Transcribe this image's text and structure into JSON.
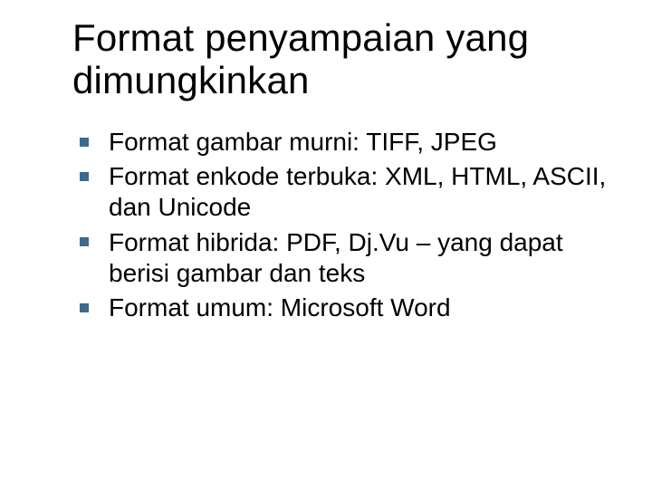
{
  "slide": {
    "title": "Format penyampaian yang dimungkinkan",
    "bullets": [
      "Format gambar murni: TIFF, JPEG",
      "Format enkode terbuka: XML, HTML, ASCII, dan Unicode",
      "Format hibrida: PDF, Dj.Vu – yang dapat berisi gambar dan teks",
      "Format umum: Microsoft Word"
    ]
  }
}
